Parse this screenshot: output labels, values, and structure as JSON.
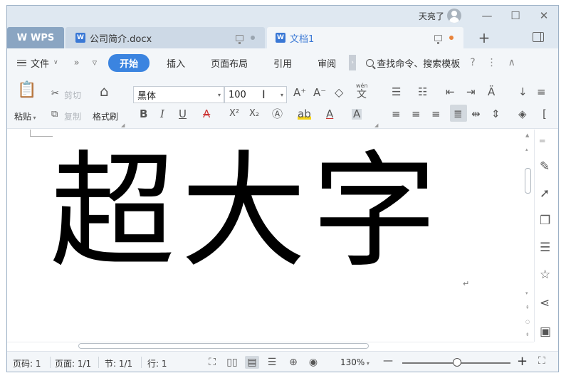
{
  "titlebar": {
    "user": "天亮了",
    "min": "—",
    "max": "☐",
    "close": "✕"
  },
  "tabs": {
    "home": "WPS",
    "doc1": "公司简介.docx",
    "doc2": "文档1",
    "new": "+",
    "docicon_letter": "W"
  },
  "menu": {
    "file": "文件",
    "chev": "»",
    "dropdown": "▿",
    "items": [
      "开始",
      "插入",
      "页面布局",
      "引用",
      "审阅"
    ],
    "more": "›",
    "search": "查找命令、搜索模板",
    "help": "?",
    "overflow": "⋮",
    "collapse": "∧"
  },
  "ribbon": {
    "paste": "粘贴",
    "cut": "剪切",
    "copy": "复制",
    "format_painter": "格式刷",
    "font_name": "黑体",
    "font_size": "100",
    "bold": "B",
    "italic": "I",
    "underline": "U",
    "strike": "A",
    "superscript": "X²",
    "subscript": "X₂",
    "grow": "A⁺",
    "shrink": "A⁻",
    "phonetic": "wén",
    "phonetic_char": "文"
  },
  "document": {
    "text": "超大字",
    "para_mark": "↵"
  },
  "status": {
    "page": "页码: 1",
    "pages": "页面: 1/1",
    "section": "节: 1/1",
    "line": "行: 1",
    "zoom": "130%",
    "zoom_minus": "—",
    "zoom_plus": "+"
  },
  "colors": {
    "accent": "#3b84e0",
    "chrome": "#dfe8f1",
    "ribbon_bg": "#f3f6f9"
  },
  "icons": [
    "wps-logo-icon",
    "monitor-icon",
    "search-icon",
    "paste-icon",
    "scissors-icon",
    "copy-icon",
    "brush-icon",
    "eraser-icon",
    "list-bullet-icon",
    "list-number-icon",
    "align-left-icon",
    "align-center-icon",
    "align-right-icon",
    "justify-icon",
    "pencil-icon",
    "cursor-icon",
    "shapes-icon",
    "sliders-icon",
    "star-icon",
    "share-icon",
    "box-icon"
  ]
}
